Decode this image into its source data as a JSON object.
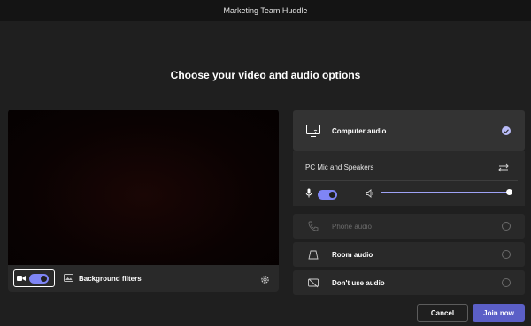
{
  "window": {
    "title": "Marketing Team Huddle"
  },
  "heading": "Choose your video and audio options",
  "video": {
    "camera_toggle_on": true,
    "background_filters_label": "Background filters"
  },
  "audio": {
    "options": {
      "computer": {
        "label": "Computer audio",
        "selected": true
      },
      "phone": {
        "label": "Phone audio",
        "selected": false,
        "disabled": true
      },
      "room": {
        "label": "Room audio",
        "selected": false
      },
      "none": {
        "label": "Don't use audio",
        "selected": false
      }
    },
    "device": {
      "name": "PC Mic and Speakers",
      "mic_on": true,
      "speaker_volume": 1.0
    }
  },
  "buttons": {
    "cancel": "Cancel",
    "join": "Join now"
  },
  "colors": {
    "accent": "#7f85f5",
    "primary_button": "#5b5fc7",
    "background": "#1f1f1f",
    "panel": "#292929"
  }
}
